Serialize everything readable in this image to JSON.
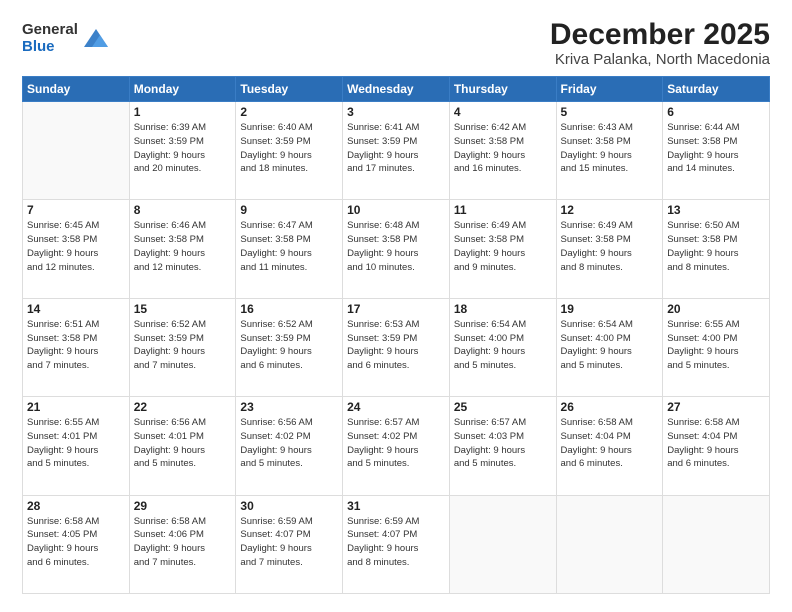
{
  "header": {
    "logo_general": "General",
    "logo_blue": "Blue",
    "title": "December 2025",
    "subtitle": "Kriva Palanka, North Macedonia"
  },
  "calendar": {
    "days_of_week": [
      "Sunday",
      "Monday",
      "Tuesday",
      "Wednesday",
      "Thursday",
      "Friday",
      "Saturday"
    ],
    "weeks": [
      [
        {
          "day": "",
          "info": ""
        },
        {
          "day": "1",
          "info": "Sunrise: 6:39 AM\nSunset: 3:59 PM\nDaylight: 9 hours\nand 20 minutes."
        },
        {
          "day": "2",
          "info": "Sunrise: 6:40 AM\nSunset: 3:59 PM\nDaylight: 9 hours\nand 18 minutes."
        },
        {
          "day": "3",
          "info": "Sunrise: 6:41 AM\nSunset: 3:59 PM\nDaylight: 9 hours\nand 17 minutes."
        },
        {
          "day": "4",
          "info": "Sunrise: 6:42 AM\nSunset: 3:58 PM\nDaylight: 9 hours\nand 16 minutes."
        },
        {
          "day": "5",
          "info": "Sunrise: 6:43 AM\nSunset: 3:58 PM\nDaylight: 9 hours\nand 15 minutes."
        },
        {
          "day": "6",
          "info": "Sunrise: 6:44 AM\nSunset: 3:58 PM\nDaylight: 9 hours\nand 14 minutes."
        }
      ],
      [
        {
          "day": "7",
          "info": "Sunrise: 6:45 AM\nSunset: 3:58 PM\nDaylight: 9 hours\nand 12 minutes."
        },
        {
          "day": "8",
          "info": "Sunrise: 6:46 AM\nSunset: 3:58 PM\nDaylight: 9 hours\nand 12 minutes."
        },
        {
          "day": "9",
          "info": "Sunrise: 6:47 AM\nSunset: 3:58 PM\nDaylight: 9 hours\nand 11 minutes."
        },
        {
          "day": "10",
          "info": "Sunrise: 6:48 AM\nSunset: 3:58 PM\nDaylight: 9 hours\nand 10 minutes."
        },
        {
          "day": "11",
          "info": "Sunrise: 6:49 AM\nSunset: 3:58 PM\nDaylight: 9 hours\nand 9 minutes."
        },
        {
          "day": "12",
          "info": "Sunrise: 6:49 AM\nSunset: 3:58 PM\nDaylight: 9 hours\nand 8 minutes."
        },
        {
          "day": "13",
          "info": "Sunrise: 6:50 AM\nSunset: 3:58 PM\nDaylight: 9 hours\nand 8 minutes."
        }
      ],
      [
        {
          "day": "14",
          "info": "Sunrise: 6:51 AM\nSunset: 3:58 PM\nDaylight: 9 hours\nand 7 minutes."
        },
        {
          "day": "15",
          "info": "Sunrise: 6:52 AM\nSunset: 3:59 PM\nDaylight: 9 hours\nand 7 minutes."
        },
        {
          "day": "16",
          "info": "Sunrise: 6:52 AM\nSunset: 3:59 PM\nDaylight: 9 hours\nand 6 minutes."
        },
        {
          "day": "17",
          "info": "Sunrise: 6:53 AM\nSunset: 3:59 PM\nDaylight: 9 hours\nand 6 minutes."
        },
        {
          "day": "18",
          "info": "Sunrise: 6:54 AM\nSunset: 4:00 PM\nDaylight: 9 hours\nand 5 minutes."
        },
        {
          "day": "19",
          "info": "Sunrise: 6:54 AM\nSunset: 4:00 PM\nDaylight: 9 hours\nand 5 minutes."
        },
        {
          "day": "20",
          "info": "Sunrise: 6:55 AM\nSunset: 4:00 PM\nDaylight: 9 hours\nand 5 minutes."
        }
      ],
      [
        {
          "day": "21",
          "info": "Sunrise: 6:55 AM\nSunset: 4:01 PM\nDaylight: 9 hours\nand 5 minutes."
        },
        {
          "day": "22",
          "info": "Sunrise: 6:56 AM\nSunset: 4:01 PM\nDaylight: 9 hours\nand 5 minutes."
        },
        {
          "day": "23",
          "info": "Sunrise: 6:56 AM\nSunset: 4:02 PM\nDaylight: 9 hours\nand 5 minutes."
        },
        {
          "day": "24",
          "info": "Sunrise: 6:57 AM\nSunset: 4:02 PM\nDaylight: 9 hours\nand 5 minutes."
        },
        {
          "day": "25",
          "info": "Sunrise: 6:57 AM\nSunset: 4:03 PM\nDaylight: 9 hours\nand 5 minutes."
        },
        {
          "day": "26",
          "info": "Sunrise: 6:58 AM\nSunset: 4:04 PM\nDaylight: 9 hours\nand 6 minutes."
        },
        {
          "day": "27",
          "info": "Sunrise: 6:58 AM\nSunset: 4:04 PM\nDaylight: 9 hours\nand 6 minutes."
        }
      ],
      [
        {
          "day": "28",
          "info": "Sunrise: 6:58 AM\nSunset: 4:05 PM\nDaylight: 9 hours\nand 6 minutes."
        },
        {
          "day": "29",
          "info": "Sunrise: 6:58 AM\nSunset: 4:06 PM\nDaylight: 9 hours\nand 7 minutes."
        },
        {
          "day": "30",
          "info": "Sunrise: 6:59 AM\nSunset: 4:07 PM\nDaylight: 9 hours\nand 7 minutes."
        },
        {
          "day": "31",
          "info": "Sunrise: 6:59 AM\nSunset: 4:07 PM\nDaylight: 9 hours\nand 8 minutes."
        },
        {
          "day": "",
          "info": ""
        },
        {
          "day": "",
          "info": ""
        },
        {
          "day": "",
          "info": ""
        }
      ]
    ]
  }
}
